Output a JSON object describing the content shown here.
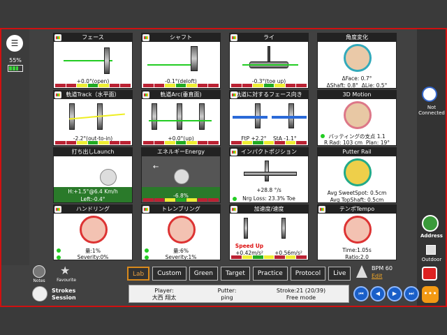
{
  "battery": {
    "percent": "55%"
  },
  "panels": {
    "face": {
      "title": "フェース",
      "value": "+0.0°(open)"
    },
    "shaft": {
      "title": "シャフト",
      "value": "-0.1°(deloft)"
    },
    "lie": {
      "title": "ライ",
      "value": "-0.3°(toe up)"
    },
    "angle": {
      "title": "角度変化",
      "line1": "ΔFace: 0.7°",
      "line2a": "ΔShaft: 0.8°",
      "line2b": "ΔLie: 0.5°"
    },
    "track": {
      "title": "軌道Track（水平面）",
      "value": "-2.2°(out-to-in)"
    },
    "arc": {
      "title": "軌道Arc(垂直面)",
      "value": "+0.0°(up)"
    },
    "facetopath": {
      "title": "軌道に対するフェース向き",
      "ftp": "FtP +2.2°",
      "sta": "StA -1.1°"
    },
    "motion": {
      "title": "3D Motion",
      "line1": "バッティングの支点 1.1",
      "line2a": "R Rad: 103 cm",
      "line2b": "Plan: 19°"
    },
    "launch": {
      "title": "打ち出しLaunch",
      "line1": "H:+1.5°@6.4 Km/h",
      "line2": "Left:-0.4°"
    },
    "energy": {
      "title": "エネルギーEnergy",
      "value": "-6.8%"
    },
    "impact": {
      "title": "インパクトポジション",
      "line1": "+28.8 °/s",
      "line2": "Nrg Loss: 23.3% Toe"
    },
    "rail": {
      "title": "Putter Rail",
      "line1": "Avg SweetSpot: 0.5cm",
      "line2": "Avg TopShaft: 0.5cm"
    },
    "handring": {
      "title": "ハンドリング",
      "line1": "量:1%",
      "line2": "Severity:0%"
    },
    "trembling": {
      "title": "トレンブリング",
      "line1": "量:6%",
      "line2": "Severity:1%"
    },
    "accel": {
      "title": "加速度/速度",
      "warn": "Speed Up",
      "v1": "+0.42m/s²",
      "v2": "+0.56m/s²"
    },
    "tempo": {
      "title": "テンポTempo",
      "line1": "Time:1.05s",
      "line2": "Ratio:2.0"
    }
  },
  "right": {
    "status": "Not Connected",
    "address": "Address",
    "outdoor": "Outdoor"
  },
  "tabs": [
    "Lab",
    "Custom",
    "Green",
    "Target",
    "Practice",
    "Protocol",
    "Live"
  ],
  "bpm": {
    "label": "BPM 60",
    "edit": "Edit"
  },
  "bottom": {
    "notes": "Notes",
    "favourite": "Favourite",
    "strokes1": "Strokes",
    "strokes2": "Session"
  },
  "info": {
    "player_label": "Player:",
    "player": "大西 翔太",
    "putter_label": "Putter:",
    "putter": "ping",
    "stroke_label": "Stroke:21 (20/39)",
    "mode": "Free mode"
  },
  "colors": {
    "frame": "#d01010",
    "accent": "#d98a1c",
    "nav": "#1a5fc8"
  }
}
